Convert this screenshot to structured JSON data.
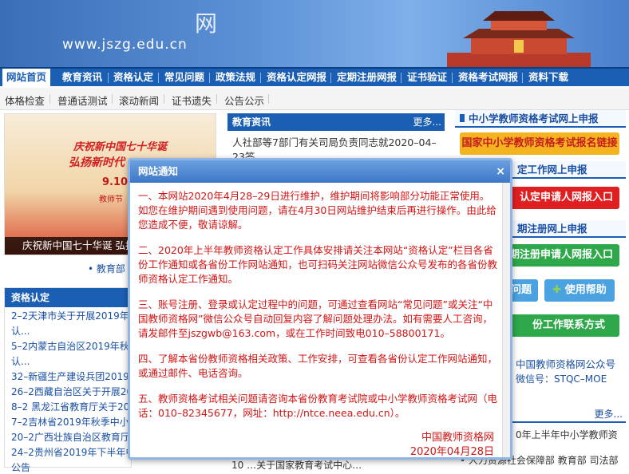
{
  "header": {
    "site_char": "网",
    "site_url": "www.jszg.edu.cn"
  },
  "nav": {
    "items": [
      "网站首页",
      "教育资讯",
      "资格认定",
      "常见问题",
      "政策法规",
      "资格认定网报",
      "定期注册网报",
      "证书验证",
      "资格考试网报",
      "资料下载"
    ]
  },
  "subnav": {
    "items": [
      "体格检查",
      "普通话测试",
      "滚动新闻",
      "证书遗失",
      "公告公示"
    ]
  },
  "slideshow": {
    "line1": "庆祝新中国七十华诞",
    "line2": "弘扬新时代",
    "date": "9.10",
    "sub": "教师节",
    "caption": "庆祝新中国七十华诞 弘扬新时代",
    "more_link": "• 教育部"
  },
  "news": {
    "header": "教育资讯",
    "more": "更多...",
    "first_item": "人社部等7部门有关司局负责同志就2020–04–23答..."
  },
  "right_panel": {
    "section1_title": "中小学教师资格考试网上申报",
    "section1_button": "国家中小学教师资格考试报名链接",
    "section2_title": "定工作网上申报",
    "section2_button": "认定申请人网报入口",
    "section3_title": "期注册网上申报",
    "section3_button": "期注册申请人网报入口",
    "faq_button": "问题",
    "help_button": "使用帮助",
    "contact_button": "份工作联系方式",
    "wechat_title": "中国教师资格网公众号",
    "wechat_id": "微信号：STQC–MOE",
    "more": "更多...",
    "notice_line": "0年上半年中小学教师资",
    "bottom_line": "• 人力资源社会保障部 教育部 司法部"
  },
  "left_col": {
    "header": "资格认定",
    "items": [
      "2–2天津市关于开展2019年",
      "认...",
      "5–2内蒙古自治区2019年秋",
      "认...",
      "32–新疆生产建设兵团2019",
      "26–2西藏自治区关于开展20",
      "8–2 黑龙江省教育厅关于20",
      "7–2吉林省2019年秋季中小",
      "20–2广西壮族自治区教育厅",
      "24–2贵州省2019年下半年中",
      "公告"
    ]
  },
  "bottom_mid": "10  …关于国家教育考试中心…",
  "modal": {
    "title": "网站通知",
    "close": "×",
    "paragraphs": [
      "一、本网站2020年4月28–29日进行维护，维护期间将影响部分功能正常使用。如您在维护期间遇到使用问题，请在4月30日网站维护结束后再进行操作。由此给您造成不便，敬请谅解。",
      "二、2020年上半年教师资格认定工作具体安排请关注本网站“资格认定”栏目各省份工作通知或各省份工作网站通知，也可扫码关注网站微信公众号发布的各省份教师资格认定工作通知。",
      "三、账号注册、登录或认定过程中的问题，可通过查看网站“常见问题”或关注“中国教师资格网”微信公众号自动回复内容了解问题处理办法。如有需要人工咨询，请发邮件至jszgwb@163.com，或在工作时间致电010–58800171。",
      "四、了解本省份教师资格相关政策、工作安排，可查看各省份认定工作网站通知，或通过邮件、电话咨询。",
      "五、教师资格考试相关问题请咨询本省份教育考试院或中小学教师资格考试网（电话：010–82345677，网址：http://ntce.neea.edu.cn）。"
    ],
    "sign_org": "中国教师资格网",
    "sign_date": "2020年04月28日"
  },
  "colors": {
    "nav_blue": "#1a5fb4",
    "notice_red": "#d21515",
    "button_red": "#e02020",
    "button_green": "#2ea84a",
    "button_gold": "#f3b420"
  }
}
